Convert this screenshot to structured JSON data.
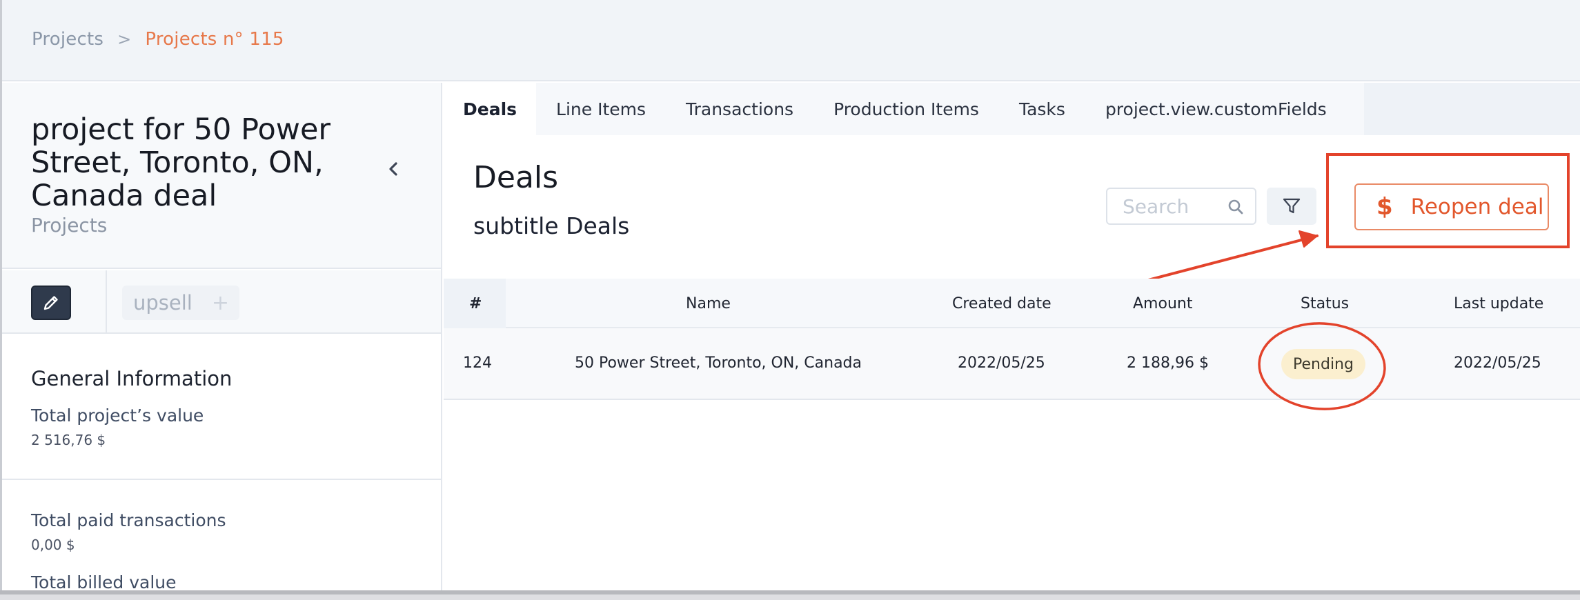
{
  "breadcrumb": {
    "root": "Projects",
    "separator": ">",
    "current": "Projects n° 115"
  },
  "project": {
    "title": "project for 50 Power Street, Toronto, ON, Canada deal",
    "subtitle": "Projects",
    "tag": "upsell"
  },
  "general_info": {
    "title": "General Information",
    "total_value_label": "Total project’s value",
    "total_value": "2 516,76 $",
    "paid_label": "Total paid transactions",
    "paid_value": "0,00 $",
    "billed_label": "Total billed value"
  },
  "tabs": [
    {
      "label": "Deals",
      "active": true
    },
    {
      "label": "Line Items",
      "active": false
    },
    {
      "label": "Transactions",
      "active": false
    },
    {
      "label": "Production Items",
      "active": false
    },
    {
      "label": "Tasks",
      "active": false
    },
    {
      "label": "project.view.customFields",
      "active": false
    }
  ],
  "main": {
    "title": "Deals",
    "subtitle": "subtitle Deals",
    "search_placeholder": "Search",
    "reopen_label": "Reopen deal"
  },
  "table": {
    "headers": {
      "id": "#",
      "name": "Name",
      "created": "Created date",
      "amount": "Amount",
      "status": "Status",
      "updated": "Last update"
    },
    "rows": [
      {
        "id": "124",
        "name": "50 Power Street, Toronto, ON, Canada",
        "created": "2022/05/25",
        "amount": "2 188,96 $",
        "status": "Pending",
        "updated": "2022/05/25"
      }
    ]
  },
  "colors": {
    "accent": "#e2572c",
    "annotation": "#e3432b",
    "breadcrumb_current": "#e7784a",
    "status_pending_bg": "#fbefcf"
  }
}
